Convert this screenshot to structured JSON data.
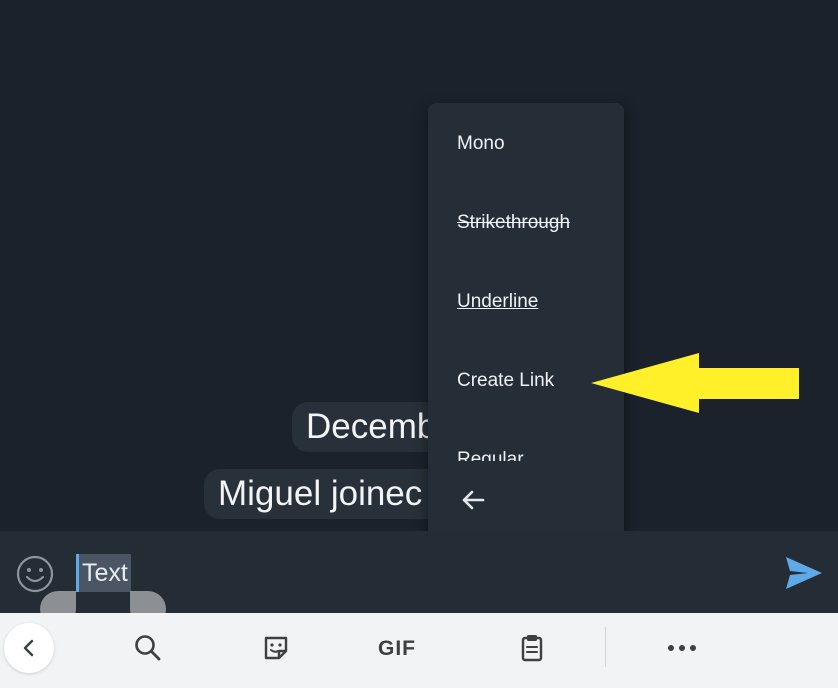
{
  "chat": {
    "date_pill": "Decemb",
    "service_message": "Miguel joinec"
  },
  "context_menu": {
    "items": [
      {
        "label": "Mono"
      },
      {
        "label": "Strikethrough"
      },
      {
        "label": "Underline"
      },
      {
        "label": "Create Link"
      },
      {
        "label": "Regular"
      }
    ],
    "back_icon": "arrow-left-icon"
  },
  "annotation": {
    "arrow_color": "#fff02a",
    "points_to": "Create Link"
  },
  "composer": {
    "selected_text": "Text",
    "emoji_icon": "smiley-icon",
    "send_icon": "send-icon",
    "send_color": "#5ea9e8"
  },
  "keyboard_toolbar": {
    "gif_label": "GIF",
    "icons": [
      "chevron-left-icon",
      "search-icon",
      "sticker-icon",
      "clipboard-icon",
      "more-horizontal-icon"
    ]
  }
}
